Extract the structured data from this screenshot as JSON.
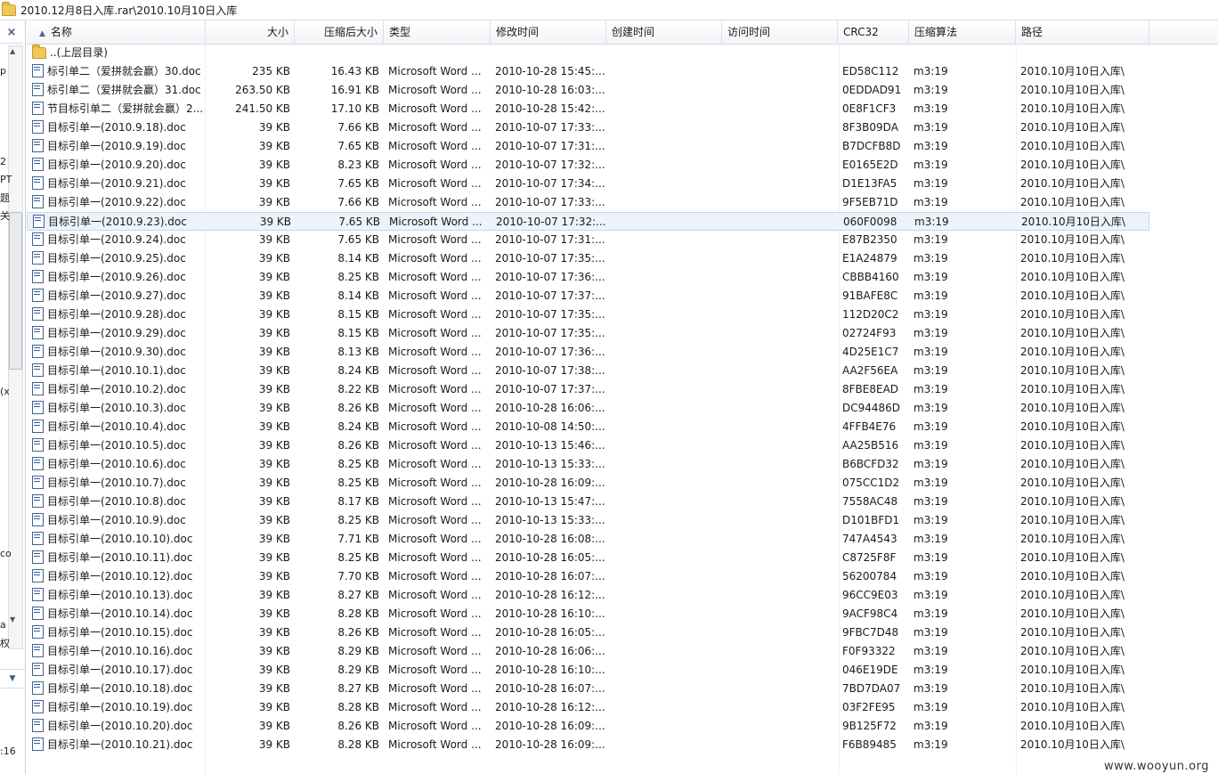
{
  "path_bar": {
    "path": "2010.12月8日入库.rar\\2010.10月10日入库"
  },
  "left_panel": {
    "close_glyph": "×",
    "fragments": [
      "p",
      "2",
      "PT",
      "题",
      "关",
      "(x",
      "co",
      "a",
      "权",
      ":16"
    ]
  },
  "columns": {
    "name": "名称",
    "size": "大小",
    "packed": "压缩后大小",
    "type": "类型",
    "modified": "修改时间",
    "created": "创建时间",
    "accessed": "访问时间",
    "crc": "CRC32",
    "method": "压缩算法",
    "path": "路径"
  },
  "parent_row": {
    "label": "..(上层目录)"
  },
  "files": [
    {
      "name": "标引单二（爱拼就会赢）30.doc",
      "size": "235 KB",
      "packed": "16.43 KB",
      "type": "Microsoft Word ...",
      "modified": "2010-10-28 15:45:...",
      "crc": "ED58C112",
      "method": "m3:19",
      "path": "2010.10月10日入库\\"
    },
    {
      "name": "标引单二（爱拼就会赢）31.doc",
      "size": "263.50 KB",
      "packed": "16.91 KB",
      "type": "Microsoft Word ...",
      "modified": "2010-10-28 16:03:...",
      "crc": "0EDDAD91",
      "method": "m3:19",
      "path": "2010.10月10日入库\\"
    },
    {
      "name": "节目标引单二（爱拼就会赢）2...",
      "size": "241.50 KB",
      "packed": "17.10 KB",
      "type": "Microsoft Word ...",
      "modified": "2010-10-28 15:42:...",
      "crc": "0E8F1CF3",
      "method": "m3:19",
      "path": "2010.10月10日入库\\"
    },
    {
      "name": "目标引单一(2010.9.18).doc",
      "size": "39 KB",
      "packed": "7.66 KB",
      "type": "Microsoft Word ...",
      "modified": "2010-10-07 17:33:...",
      "crc": "8F3B09DA",
      "method": "m3:19",
      "path": "2010.10月10日入库\\"
    },
    {
      "name": "目标引单一(2010.9.19).doc",
      "size": "39 KB",
      "packed": "7.65 KB",
      "type": "Microsoft Word ...",
      "modified": "2010-10-07 17:31:...",
      "crc": "B7DCFB8D",
      "method": "m3:19",
      "path": "2010.10月10日入库\\"
    },
    {
      "name": "目标引单一(2010.9.20).doc",
      "size": "39 KB",
      "packed": "8.23 KB",
      "type": "Microsoft Word ...",
      "modified": "2010-10-07 17:32:...",
      "crc": "E0165E2D",
      "method": "m3:19",
      "path": "2010.10月10日入库\\"
    },
    {
      "name": "目标引单一(2010.9.21).doc",
      "size": "39 KB",
      "packed": "7.65 KB",
      "type": "Microsoft Word ...",
      "modified": "2010-10-07 17:34:...",
      "crc": "D1E13FA5",
      "method": "m3:19",
      "path": "2010.10月10日入库\\"
    },
    {
      "name": "目标引单一(2010.9.22).doc",
      "size": "39 KB",
      "packed": "7.66 KB",
      "type": "Microsoft Word ...",
      "modified": "2010-10-07 17:33:...",
      "crc": "9F5EB71D",
      "method": "m3:19",
      "path": "2010.10月10日入库\\"
    },
    {
      "name": "目标引单一(2010.9.23).doc",
      "size": "39 KB",
      "packed": "7.65 KB",
      "type": "Microsoft Word ...",
      "modified": "2010-10-07 17:32:...",
      "crc": "060F0098",
      "method": "m3:19",
      "path": "2010.10月10日入库\\",
      "selected": true
    },
    {
      "name": "目标引单一(2010.9.24).doc",
      "size": "39 KB",
      "packed": "7.65 KB",
      "type": "Microsoft Word ...",
      "modified": "2010-10-07 17:31:...",
      "crc": "E87B2350",
      "method": "m3:19",
      "path": "2010.10月10日入库\\"
    },
    {
      "name": "目标引单一(2010.9.25).doc",
      "size": "39 KB",
      "packed": "8.14 KB",
      "type": "Microsoft Word ...",
      "modified": "2010-10-07 17:35:...",
      "crc": "E1A24879",
      "method": "m3:19",
      "path": "2010.10月10日入库\\"
    },
    {
      "name": "目标引单一(2010.9.26).doc",
      "size": "39 KB",
      "packed": "8.25 KB",
      "type": "Microsoft Word ...",
      "modified": "2010-10-07 17:36:...",
      "crc": "CBBB4160",
      "method": "m3:19",
      "path": "2010.10月10日入库\\"
    },
    {
      "name": "目标引单一(2010.9.27).doc",
      "size": "39 KB",
      "packed": "8.14 KB",
      "type": "Microsoft Word ...",
      "modified": "2010-10-07 17:37:...",
      "crc": "91BAFE8C",
      "method": "m3:19",
      "path": "2010.10月10日入库\\"
    },
    {
      "name": "目标引单一(2010.9.28).doc",
      "size": "39 KB",
      "packed": "8.15 KB",
      "type": "Microsoft Word ...",
      "modified": "2010-10-07 17:35:...",
      "crc": "112D20C2",
      "method": "m3:19",
      "path": "2010.10月10日入库\\"
    },
    {
      "name": "目标引单一(2010.9.29).doc",
      "size": "39 KB",
      "packed": "8.15 KB",
      "type": "Microsoft Word ...",
      "modified": "2010-10-07 17:35:...",
      "crc": "02724F93",
      "method": "m3:19",
      "path": "2010.10月10日入库\\"
    },
    {
      "name": "目标引单一(2010.9.30).doc",
      "size": "39 KB",
      "packed": "8.13 KB",
      "type": "Microsoft Word ...",
      "modified": "2010-10-07 17:36:...",
      "crc": "4D25E1C7",
      "method": "m3:19",
      "path": "2010.10月10日入库\\"
    },
    {
      "name": "目标引单一(2010.10.1).doc",
      "size": "39 KB",
      "packed": "8.24 KB",
      "type": "Microsoft Word ...",
      "modified": "2010-10-07 17:38:...",
      "crc": "AA2F56EA",
      "method": "m3:19",
      "path": "2010.10月10日入库\\"
    },
    {
      "name": "目标引单一(2010.10.2).doc",
      "size": "39 KB",
      "packed": "8.22 KB",
      "type": "Microsoft Word ...",
      "modified": "2010-10-07 17:37:...",
      "crc": "8FBE8EAD",
      "method": "m3:19",
      "path": "2010.10月10日入库\\"
    },
    {
      "name": "目标引单一(2010.10.3).doc",
      "size": "39 KB",
      "packed": "8.26 KB",
      "type": "Microsoft Word ...",
      "modified": "2010-10-28 16:06:...",
      "crc": "DC94486D",
      "method": "m3:19",
      "path": "2010.10月10日入库\\"
    },
    {
      "name": "目标引单一(2010.10.4).doc",
      "size": "39 KB",
      "packed": "8.24 KB",
      "type": "Microsoft Word ...",
      "modified": "2010-10-08 14:50:...",
      "crc": "4FFB4E76",
      "method": "m3:19",
      "path": "2010.10月10日入库\\"
    },
    {
      "name": "目标引单一(2010.10.5).doc",
      "size": "39 KB",
      "packed": "8.26 KB",
      "type": "Microsoft Word ...",
      "modified": "2010-10-13 15:46:...",
      "crc": "AA25B516",
      "method": "m3:19",
      "path": "2010.10月10日入库\\"
    },
    {
      "name": "目标引单一(2010.10.6).doc",
      "size": "39 KB",
      "packed": "8.25 KB",
      "type": "Microsoft Word ...",
      "modified": "2010-10-13 15:33:...",
      "crc": "B6BCFD32",
      "method": "m3:19",
      "path": "2010.10月10日入库\\"
    },
    {
      "name": "目标引单一(2010.10.7).doc",
      "size": "39 KB",
      "packed": "8.25 KB",
      "type": "Microsoft Word ...",
      "modified": "2010-10-28 16:09:...",
      "crc": "075CC1D2",
      "method": "m3:19",
      "path": "2010.10月10日入库\\"
    },
    {
      "name": "目标引单一(2010.10.8).doc",
      "size": "39 KB",
      "packed": "8.17 KB",
      "type": "Microsoft Word ...",
      "modified": "2010-10-13 15:47:...",
      "crc": "7558AC48",
      "method": "m3:19",
      "path": "2010.10月10日入库\\"
    },
    {
      "name": "目标引单一(2010.10.9).doc",
      "size": "39 KB",
      "packed": "8.25 KB",
      "type": "Microsoft Word ...",
      "modified": "2010-10-13 15:33:...",
      "crc": "D101BFD1",
      "method": "m3:19",
      "path": "2010.10月10日入库\\"
    },
    {
      "name": "目标引单一(2010.10.10).doc",
      "size": "39 KB",
      "packed": "7.71 KB",
      "type": "Microsoft Word ...",
      "modified": "2010-10-28 16:08:...",
      "crc": "747A4543",
      "method": "m3:19",
      "path": "2010.10月10日入库\\"
    },
    {
      "name": "目标引单一(2010.10.11).doc",
      "size": "39 KB",
      "packed": "8.25 KB",
      "type": "Microsoft Word ...",
      "modified": "2010-10-28 16:05:...",
      "crc": "C8725F8F",
      "method": "m3:19",
      "path": "2010.10月10日入库\\"
    },
    {
      "name": "目标引单一(2010.10.12).doc",
      "size": "39 KB",
      "packed": "7.70 KB",
      "type": "Microsoft Word ...",
      "modified": "2010-10-28 16:07:...",
      "crc": "56200784",
      "method": "m3:19",
      "path": "2010.10月10日入库\\"
    },
    {
      "name": "目标引单一(2010.10.13).doc",
      "size": "39 KB",
      "packed": "8.27 KB",
      "type": "Microsoft Word ...",
      "modified": "2010-10-28 16:12:...",
      "crc": "96CC9E03",
      "method": "m3:19",
      "path": "2010.10月10日入库\\"
    },
    {
      "name": "目标引单一(2010.10.14).doc",
      "size": "39 KB",
      "packed": "8.28 KB",
      "type": "Microsoft Word ...",
      "modified": "2010-10-28 16:10:...",
      "crc": "9ACF98C4",
      "method": "m3:19",
      "path": "2010.10月10日入库\\"
    },
    {
      "name": "目标引单一(2010.10.15).doc",
      "size": "39 KB",
      "packed": "8.26 KB",
      "type": "Microsoft Word ...",
      "modified": "2010-10-28 16:05:...",
      "crc": "9FBC7D48",
      "method": "m3:19",
      "path": "2010.10月10日入库\\"
    },
    {
      "name": "目标引单一(2010.10.16).doc",
      "size": "39 KB",
      "packed": "8.29 KB",
      "type": "Microsoft Word ...",
      "modified": "2010-10-28 16:06:...",
      "crc": "F0F93322",
      "method": "m3:19",
      "path": "2010.10月10日入库\\"
    },
    {
      "name": "目标引单一(2010.10.17).doc",
      "size": "39 KB",
      "packed": "8.29 KB",
      "type": "Microsoft Word ...",
      "modified": "2010-10-28 16:10:...",
      "crc": "046E19DE",
      "method": "m3:19",
      "path": "2010.10月10日入库\\"
    },
    {
      "name": "目标引单一(2010.10.18).doc",
      "size": "39 KB",
      "packed": "8.27 KB",
      "type": "Microsoft Word ...",
      "modified": "2010-10-28 16:07:...",
      "crc": "7BD7DA07",
      "method": "m3:19",
      "path": "2010.10月10日入库\\"
    },
    {
      "name": "目标引单一(2010.10.19).doc",
      "size": "39 KB",
      "packed": "8.28 KB",
      "type": "Microsoft Word ...",
      "modified": "2010-10-28 16:12:...",
      "crc": "03F2FE95",
      "method": "m3:19",
      "path": "2010.10月10日入库\\"
    },
    {
      "name": "目标引单一(2010.10.20).doc",
      "size": "39 KB",
      "packed": "8.26 KB",
      "type": "Microsoft Word ...",
      "modified": "2010-10-28 16:09:...",
      "crc": "9B125F72",
      "method": "m3:19",
      "path": "2010.10月10日入库\\"
    },
    {
      "name": "目标引单一(2010.10.21).doc",
      "size": "39 KB",
      "packed": "8.28 KB",
      "type": "Microsoft Word ...",
      "modified": "2010-10-28 16:09:...",
      "crc": "F6B89485",
      "method": "m3:19",
      "path": "2010.10月10日入库\\"
    }
  ],
  "watermark": "www.wooyun.org",
  "colors": {
    "selection_bg": "#ecf3fb",
    "selection_border": "#c4d8ef",
    "header_bg": "#f2f4f7",
    "folder": "#f0c85a"
  }
}
